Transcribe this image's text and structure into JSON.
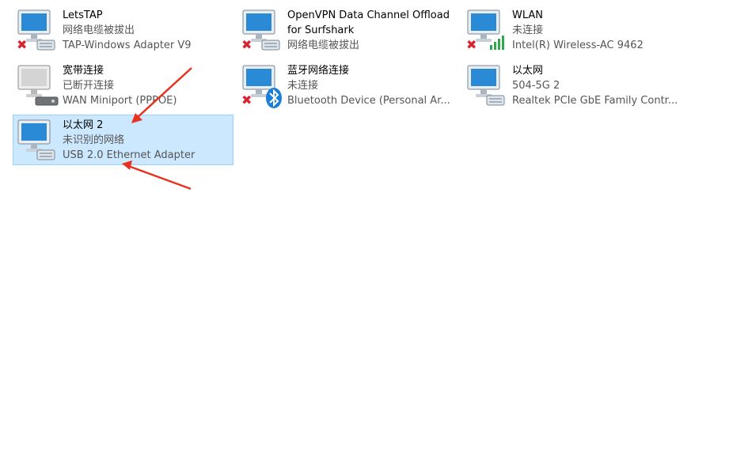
{
  "adapters": [
    {
      "name": "LetsTAP",
      "status": "网络电缆被拔出",
      "device": "TAP-Windows Adapter V9",
      "badge": "x",
      "icon": "ethernet-adapter-icon"
    },
    {
      "name": "OpenVPN Data Channel Offload for Surfshark",
      "status": "网络电缆被拔出",
      "device": "",
      "badge": "x",
      "icon": "ethernet-adapter-icon"
    },
    {
      "name": "WLAN",
      "status": "未连接",
      "device": "Intel(R) Wireless-AC 9462",
      "badge": "x",
      "icon": "wifi-adapter-icon"
    },
    {
      "name": "宽带连接",
      "status": "已断开连接",
      "device": "WAN Miniport (PPPOE)",
      "badge": "",
      "icon": "broadband-icon"
    },
    {
      "name": "蓝牙网络连接",
      "status": "未连接",
      "device": "Bluetooth Device (Personal Ar...",
      "badge": "x",
      "icon": "bluetooth-adapter-icon"
    },
    {
      "name": "以太网",
      "status": "504-5G 2",
      "device": "Realtek PCIe GbE Family Contr...",
      "badge": "",
      "icon": "ethernet-adapter-icon"
    },
    {
      "name": "以太网 2",
      "status": "未识别的网络",
      "device": "USB 2.0 Ethernet Adapter",
      "badge": "",
      "icon": "ethernet-adapter-icon",
      "selected": true
    }
  ],
  "colors": {
    "selection_bg": "#cce8ff",
    "selection_border": "#99d1ff",
    "error_x": "#d9232e",
    "annotation_arrow": "#e8321f",
    "bluetooth": "#1a7fd6",
    "wifi_bars": "#2fa84f"
  }
}
